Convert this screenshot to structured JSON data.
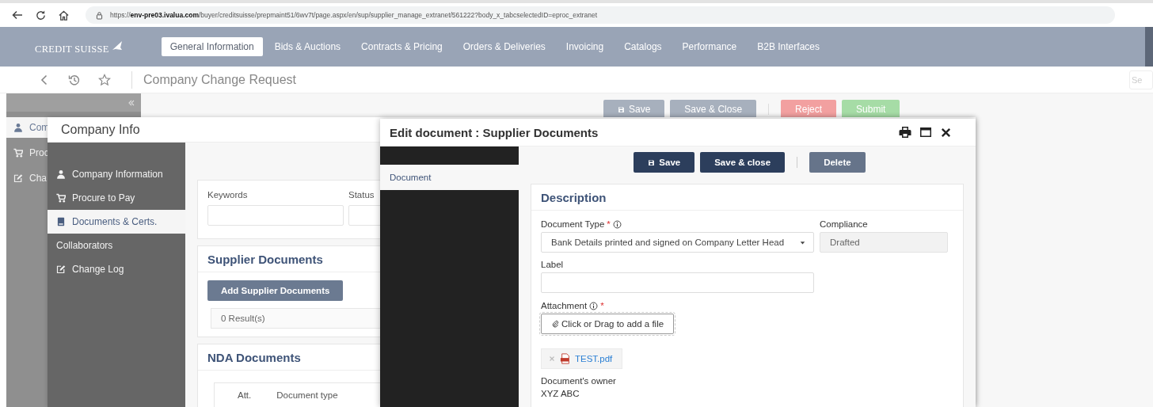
{
  "browser": {
    "url": "https://**env-pre03.ivalua.com**/buyer/creditsuisse/prepmaint51/6wv7t/page.aspx/en/sup/supplier_manage_extranet/561222?body_x_tabcselectedID=eproc_extranet"
  },
  "app_nav": {
    "logo": "CREDIT SUISSE",
    "tabs": [
      {
        "label": "General Information",
        "selected": true
      },
      {
        "label": "Bids & Auctions",
        "selected": false
      },
      {
        "label": "Contracts & Pricing",
        "selected": false
      },
      {
        "label": "Orders & Deliveries",
        "selected": false
      },
      {
        "label": "Invoicing",
        "selected": false
      },
      {
        "label": "Catalogs",
        "selected": false
      },
      {
        "label": "Performance",
        "selected": false
      },
      {
        "label": "B2B Interfaces",
        "selected": false
      }
    ]
  },
  "page_header": {
    "title": "Company Change Request",
    "search_placeholder": "Se"
  },
  "sidebar": {
    "items": [
      {
        "label": "Com",
        "selected": true
      },
      {
        "label": "Proc",
        "selected": false
      },
      {
        "label": "Cha",
        "selected": false
      }
    ]
  },
  "toolbar": [
    {
      "label": "Save",
      "kind": "save"
    },
    {
      "label": "Save & Close",
      "kind": "save_close"
    },
    {
      "label": "Reject",
      "kind": "reject"
    },
    {
      "label": "Submit",
      "kind": "submit"
    }
  ],
  "company_info": {
    "title": "Company Info",
    "nav": [
      {
        "label": "Company Information",
        "selected": false
      },
      {
        "label": "Procure to Pay",
        "selected": false
      },
      {
        "label": "Documents & Certs.",
        "selected": true
      },
      {
        "label": "Collaborators",
        "selected": false
      },
      {
        "label": "Change Log",
        "selected": false
      }
    ],
    "filters": [
      {
        "label": "Keywords"
      },
      {
        "label": "Status"
      }
    ],
    "supplier_documents": {
      "title": "Supplier Documents",
      "add_button": "Add Supplier Documents",
      "results": "0 Result(s)"
    },
    "nda_documents": {
      "title": "NDA Documents",
      "columns": [
        "Att.",
        "Document type"
      ]
    }
  },
  "modal": {
    "title": "Edit document : Supplier Documents",
    "nav": [
      {
        "label": "Document",
        "selected": true
      }
    ],
    "actions": [
      {
        "label": "Save",
        "kind": "primary"
      },
      {
        "label": "Save & close",
        "kind": "primary"
      },
      {
        "label": "Delete",
        "kind": "secondary"
      }
    ],
    "section_title": "Description",
    "document_type": {
      "label": "Document Type",
      "required_mark": "*",
      "value": "Bank Details printed and signed on Company Letter Head"
    },
    "compliance": {
      "label": "Compliance",
      "value": "Drafted"
    },
    "label_field": {
      "label": "Label"
    },
    "attachment": {
      "label": "Attachment",
      "required_mark": "*",
      "button": "Click or Drag to add a file",
      "file": "TEST.pdf"
    },
    "owner": {
      "label": "Document's owner",
      "value": "XYZ ABC"
    }
  }
}
